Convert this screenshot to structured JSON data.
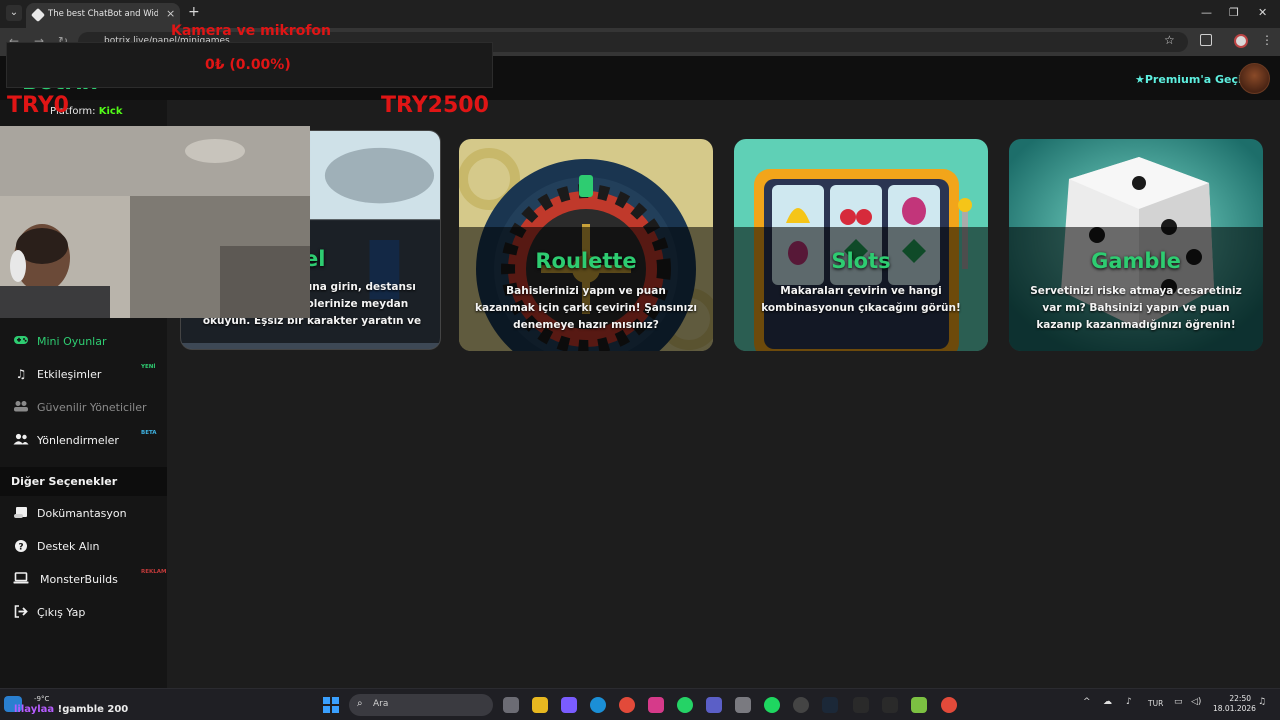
{
  "browser": {
    "tab_title": "The best ChatBot and Widgets",
    "new_tab_symbol": "+",
    "tab_close_symbol": "×",
    "url": "botrix.live/panel/minigames"
  },
  "header": {
    "logo_text": "Botrix",
    "premium_label": "Premium'a Geçin",
    "accent_color": "#2ecc71",
    "premium_color": "#5ef0e0"
  },
  "platform": {
    "label": "Platform:",
    "value": "Kick"
  },
  "sidebar": {
    "items": [
      {
        "label": "Mini Oyunlar",
        "icon": "gamepad-icon",
        "state": "active"
      },
      {
        "label": "Etkileşimler",
        "icon": "music-note-icon",
        "badge": "YENİ",
        "badge_color": "#2ecc71"
      },
      {
        "label": "Güvenilir Yöneticiler",
        "icon": "users-muted-icon",
        "state": "muted"
      },
      {
        "label": "Yönlendirmeler",
        "icon": "users-icon",
        "badge": "BETA",
        "badge_color": "#3fb6e6"
      }
    ],
    "section_title": "Diğer Seçenekler",
    "other_items": [
      {
        "label": "Dokümantasyon",
        "icon": "scroll-icon"
      },
      {
        "label": "Destek Alın",
        "icon": "question-circle-icon"
      },
      {
        "label": "MonsterBuilds",
        "icon": "laptop-icon",
        "badge": "REKLAM",
        "badge_color": "#c23a3a"
      },
      {
        "label": "Çıkış Yap",
        "icon": "sign-out-icon"
      }
    ]
  },
  "cards": [
    {
      "title": "Duel",
      "visible_title": "uel",
      "description": "Mücadele arenasına girin, destansı savaşlarda rakiplerinize meydan okuyun. Eşsiz bir karakter yaratın ve onu özelleştirilebilir beceriler."
    },
    {
      "title": "Roulette",
      "description": "Bahislerinizi yapın ve puan kazanmak için çarkı çevirin! Şansınızı denemeye hazır mısınız?"
    },
    {
      "title": "Slots",
      "description": "Makaraları çevirin ve hangi kombinasyonun çıkacağını görün! Şanslı büyük ikramiye sahibi olup bonus"
    },
    {
      "title": "Gamble",
      "description": "Servetinizi riske atmaya cesaretiniz var mı? Bahsinizi yapın ve puan kazanıp kazanmadığınızı öğrenin!"
    }
  ],
  "overlay": {
    "camera_label": "Kamera ve mikrofon",
    "balance_change": "0₺ (0.00%)",
    "left_amount": "TRY0",
    "right_amount": "TRY2500",
    "color": "#e01515"
  },
  "taskbar": {
    "temperature": "-9°C",
    "ticker_name": "lilaylaa",
    "ticker_text": "!gamble 200",
    "search_placeholder": "Ara",
    "language": "TUR",
    "time": "22:50",
    "date": "18.01.2026"
  }
}
